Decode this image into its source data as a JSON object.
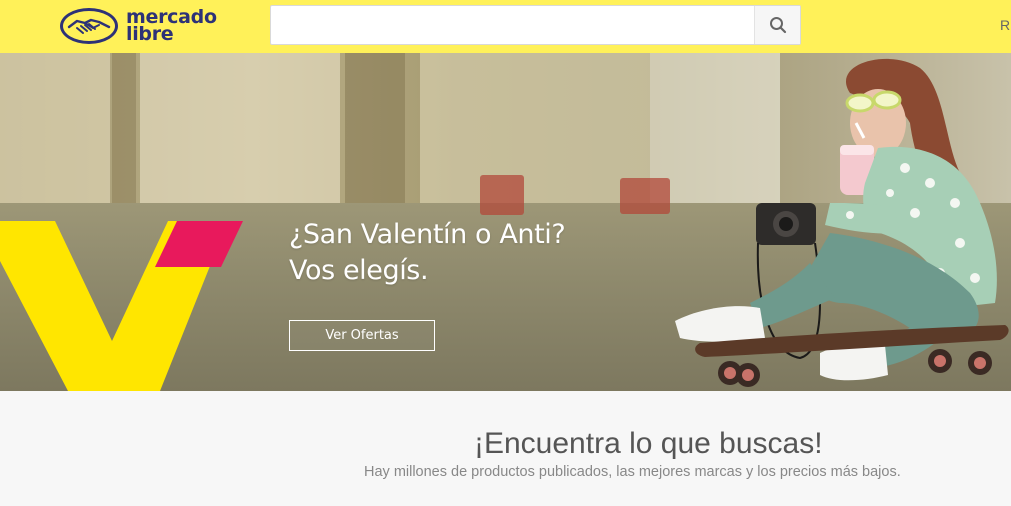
{
  "header": {
    "logo_line1": "mercado",
    "logo_line2": "libre",
    "search_placeholder": "",
    "search_value": "",
    "right_text": "R",
    "bg_color": "#fff159",
    "brand_color": "#2d3277"
  },
  "banner": {
    "headline_line1": "¿San Valentín o Anti?",
    "headline_line2": "Vos elegís.",
    "cta_label": "Ver Ofertas",
    "accent_yellow": "#ffe600",
    "accent_pink": "#e8195c"
  },
  "section": {
    "title": "¡Encuentra lo que buscas!",
    "subtitle": "Hay millones de productos publicados, las mejores marcas y los precios más bajos."
  },
  "icons": {
    "search": "search-icon",
    "logo": "handshake-icon"
  }
}
